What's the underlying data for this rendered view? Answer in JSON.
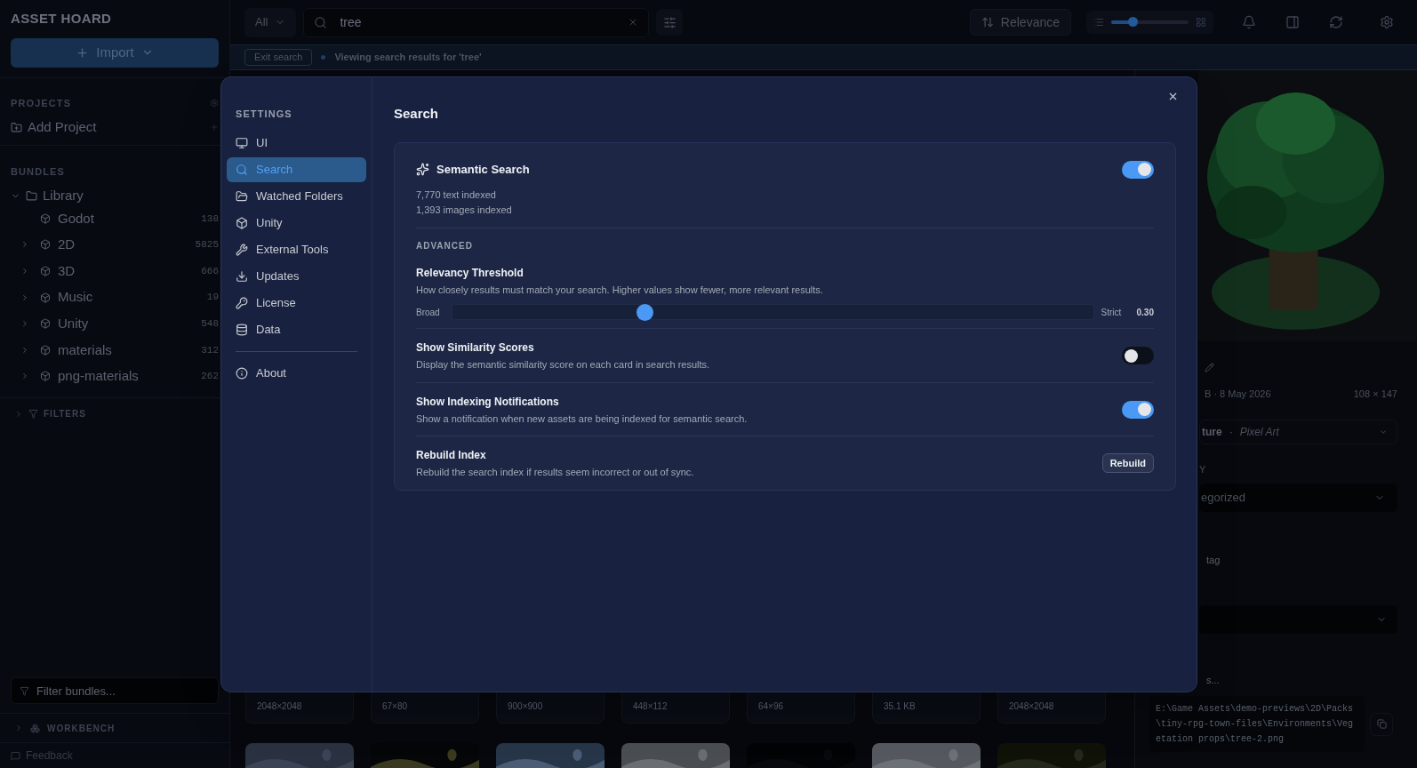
{
  "sidebar": {
    "app_title": "ASSET HOARD",
    "import_button": "Import",
    "projects": {
      "heading": "PROJECTS",
      "items": [
        {
          "label": "Add Project"
        }
      ]
    },
    "bundles": {
      "heading": "BUNDLES",
      "items": [
        {
          "label": "Library",
          "expanded": true,
          "children": [
            {
              "label": "Godot",
              "count": "138"
            },
            {
              "label": "2D",
              "count": "5825",
              "expanded": false
            },
            {
              "label": "3D",
              "count": "666",
              "expanded": false
            },
            {
              "label": "Music",
              "count": "19",
              "expanded": false
            },
            {
              "label": "Unity",
              "count": "548",
              "expanded": false
            },
            {
              "label": "materials",
              "count": "312",
              "expanded": false
            },
            {
              "label": "png-materials",
              "count": "262",
              "expanded": false
            }
          ]
        }
      ]
    },
    "filters": {
      "label": "FILTERS",
      "expanded": false
    },
    "filter_field": {
      "placeholder": "Filter bundles..."
    },
    "workbench": {
      "label": "WORKBENCH",
      "expanded": false
    },
    "feedback": "Feedback"
  },
  "toolbar": {
    "scope": "All",
    "search": {
      "value": "tree"
    },
    "sort": "Relevance",
    "size_slider": {
      "level": 0.28
    }
  },
  "search_banner": {
    "exit_button": "Exit search",
    "message": "Viewing search results for 'tree'"
  },
  "results": {
    "cards": [
      {
        "size": "2048×2048"
      },
      {
        "size": "67×80"
      },
      {
        "size": "900×900"
      },
      {
        "size": "448×112"
      },
      {
        "size": "64×96"
      },
      {
        "size": "35.1 KB"
      },
      {
        "size": "2048×2048"
      }
    ]
  },
  "details": {
    "meta": "B · 8 May 2026",
    "dimensions": "108 × 147",
    "type": "ture",
    "separator": "·",
    "style": "Pixel Art",
    "category_label": "Y",
    "category": "egorized",
    "tag_hint": "tag",
    "notes_hint": "s...",
    "path": "E:\\Game Assets\\demo-previews\\2D\\Packs\\tiny-rpg-town-files\\Environments\\Vegetation props\\tree-2.png"
  },
  "settings": {
    "heading": "SETTINGS",
    "nav": [
      {
        "label": "UI",
        "selected": false
      },
      {
        "label": "Search",
        "selected": true
      },
      {
        "label": "Watched Folders",
        "selected": false
      },
      {
        "label": "Unity",
        "selected": false
      },
      {
        "label": "External Tools",
        "selected": false
      },
      {
        "label": "Updates",
        "selected": false
      },
      {
        "label": "License",
        "selected": false
      },
      {
        "label": "Data",
        "selected": false
      }
    ],
    "nav_footer": [
      {
        "label": "About",
        "selected": false
      }
    ],
    "page_title": "Search",
    "semantic": {
      "title": "Semantic Search",
      "on": true,
      "stats": [
        "7,770 text indexed",
        "1,393 images indexed"
      ]
    },
    "advanced": {
      "heading": "ADVANCED",
      "settings": [
        {
          "kind": "slider",
          "title": "Relevancy Threshold",
          "description": "How closely results must match your search. Higher values show fewer, more relevant results.",
          "min_label": "Broad",
          "max_label": "Strict",
          "level": 0.3,
          "reading": "0.30"
        },
        {
          "kind": "toggle",
          "title": "Show Similarity Scores",
          "description": "Display the semantic similarity score on each card in search results.",
          "on": false
        },
        {
          "kind": "toggle",
          "title": "Show Indexing Notifications",
          "description": "Show a notification when new assets are being indexed for semantic search.",
          "on": true
        },
        {
          "kind": "button",
          "title": "Rebuild Index",
          "description": "Rebuild the search index if results seem incorrect or out of sync.",
          "button": "Rebuild"
        }
      ]
    }
  }
}
